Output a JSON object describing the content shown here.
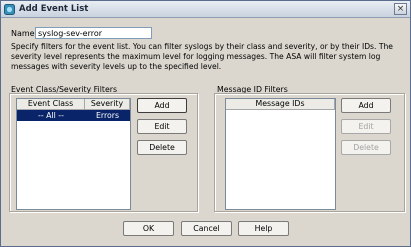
{
  "window": {
    "title": "Add Event List",
    "close_glyph": "×"
  },
  "name_field": {
    "label": "Name:",
    "value": "syslog-sev-error"
  },
  "description": "Specify filters for the event list. You can filter syslogs by their class and severity, or by their IDs. The severity level represents the maximum level for logging messages. The ASA will filter system log messages with severity levels up to the specified level.",
  "event_class_panel": {
    "title": "Event Class/Severity Filters",
    "columns": [
      "Event Class",
      "Severity"
    ],
    "rows": [
      {
        "event_class": "-- All --",
        "severity": "Errors",
        "selected": true
      }
    ],
    "buttons": {
      "add": "Add",
      "edit": "Edit",
      "delete": "Delete"
    }
  },
  "message_id_panel": {
    "title": "Message ID Filters",
    "columns": [
      "Message IDs"
    ],
    "rows": [],
    "buttons": {
      "add": "Add",
      "edit": "Edit",
      "delete": "Delete"
    }
  },
  "footer": {
    "ok": "OK",
    "cancel": "Cancel",
    "help": "Help"
  },
  "colors": {
    "selection": "#0a246a",
    "dialog_bg": "#dbd7cf"
  }
}
